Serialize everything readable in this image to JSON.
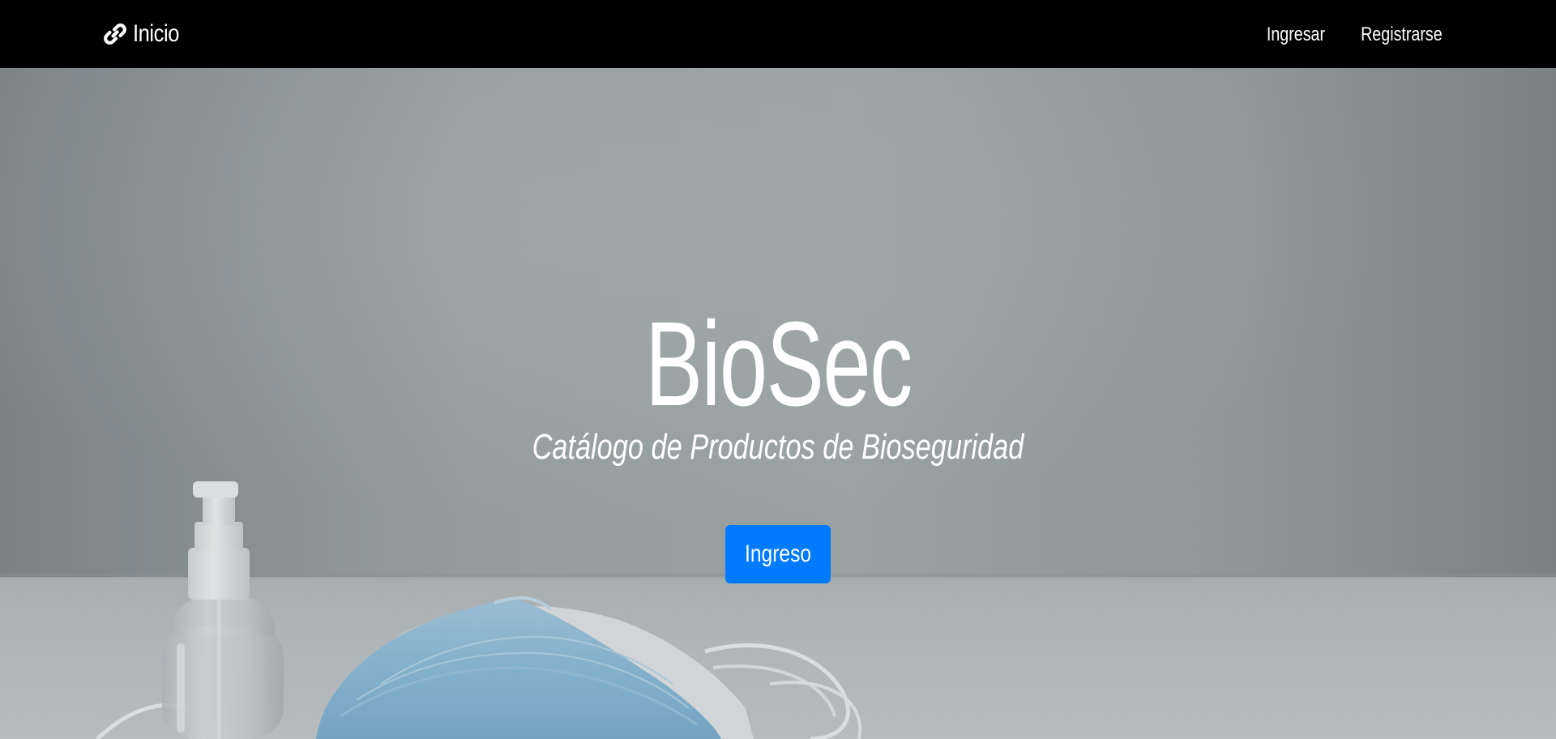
{
  "navbar": {
    "brand": {
      "icon": "link-icon",
      "label": "Inicio"
    },
    "links": [
      {
        "label": "Ingresar"
      },
      {
        "label": "Registrarse"
      }
    ]
  },
  "hero": {
    "title": "BioSec",
    "subtitle": "Catálogo de Productos de Bioseguridad",
    "cta_label": "Ingreso",
    "background_description": "spray-bottle-and-face-masks-photo"
  },
  "colors": {
    "navbar_bg": "#000000",
    "cta_bg": "#007bff",
    "text": "#ffffff"
  }
}
